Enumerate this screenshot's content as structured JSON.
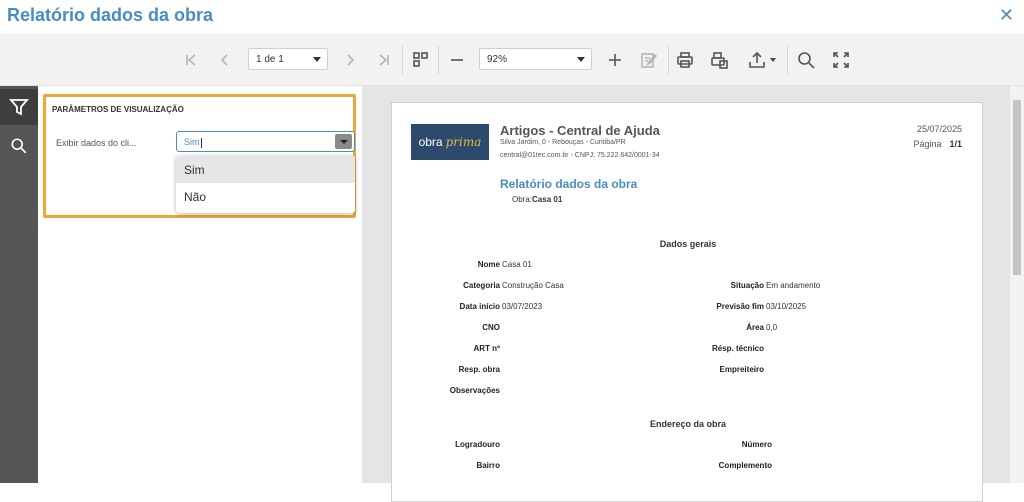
{
  "window": {
    "title": "Relatório dados da obra",
    "close_label": "✕"
  },
  "toolbar": {
    "page_select": "1 de 1",
    "zoom_select": "92%",
    "icons": [
      "first-page-icon",
      "prev-page-icon",
      "next-page-icon",
      "last-page-icon",
      "multipage-icon",
      "zoom-out-icon",
      "zoom-in-icon",
      "edit-icon",
      "print-icon",
      "print-page-icon",
      "export-icon",
      "search-icon",
      "fullscreen-icon"
    ]
  },
  "sidebar": {
    "icons": [
      "filter-icon",
      "search-icon"
    ]
  },
  "params": {
    "title": "PARÂMETROS DE VISUALIZAÇÃO",
    "label": "Exibir dados do cli...",
    "value": "Sim",
    "options": [
      "Sim",
      "Não"
    ]
  },
  "report": {
    "logo_part1": "obra",
    "logo_part2": "prima",
    "company": "Artigos - Central de Ajuda",
    "address": "Silva Jardim, 0 - Rebouças - Curitiba/PR",
    "contact": "central@01tec.com.br - CNPJ: 75.222.642/0001-34",
    "date": "25/07/2025",
    "page_label": "Página",
    "page_value": "1/1",
    "title": "Relatório dados da obra",
    "obra_label": "Obra:",
    "obra_value": "Casa 01",
    "section_general": "Dados gerais",
    "nome_label": "Nome",
    "nome_value": "Casa 01",
    "categoria_label": "Categoria",
    "categoria_value": "Construção Casa",
    "situacao_label": "Situação",
    "situacao_value": "Em andamento",
    "data_inicio_label": "Data início",
    "data_inicio_value": "03/07/2023",
    "previsao_fim_label": "Previsão fim",
    "previsao_fim_value": "03/10/2025",
    "cno_label": "CNO",
    "area_label": "Área",
    "area_value": "0,0",
    "art_label": "ART nº",
    "resp_tecnico_label": "Résp. técnico",
    "resp_obra_label": "Resp. obra",
    "empreiteiro_label": "Empreiteiro",
    "observacoes_label": "Observações",
    "section_address": "Endereço da obra",
    "logradouro_label": "Logradouro",
    "numero_label": "Número",
    "bairro_label": "Bairro",
    "complemento_label": "Complemento"
  },
  "colors": {
    "accent": "#4a8bc2",
    "highlight_border": "#e9a73b",
    "sidebar": "#555555",
    "logo_bg": "#2c4a6c",
    "logo_accent": "#e7b64a"
  }
}
